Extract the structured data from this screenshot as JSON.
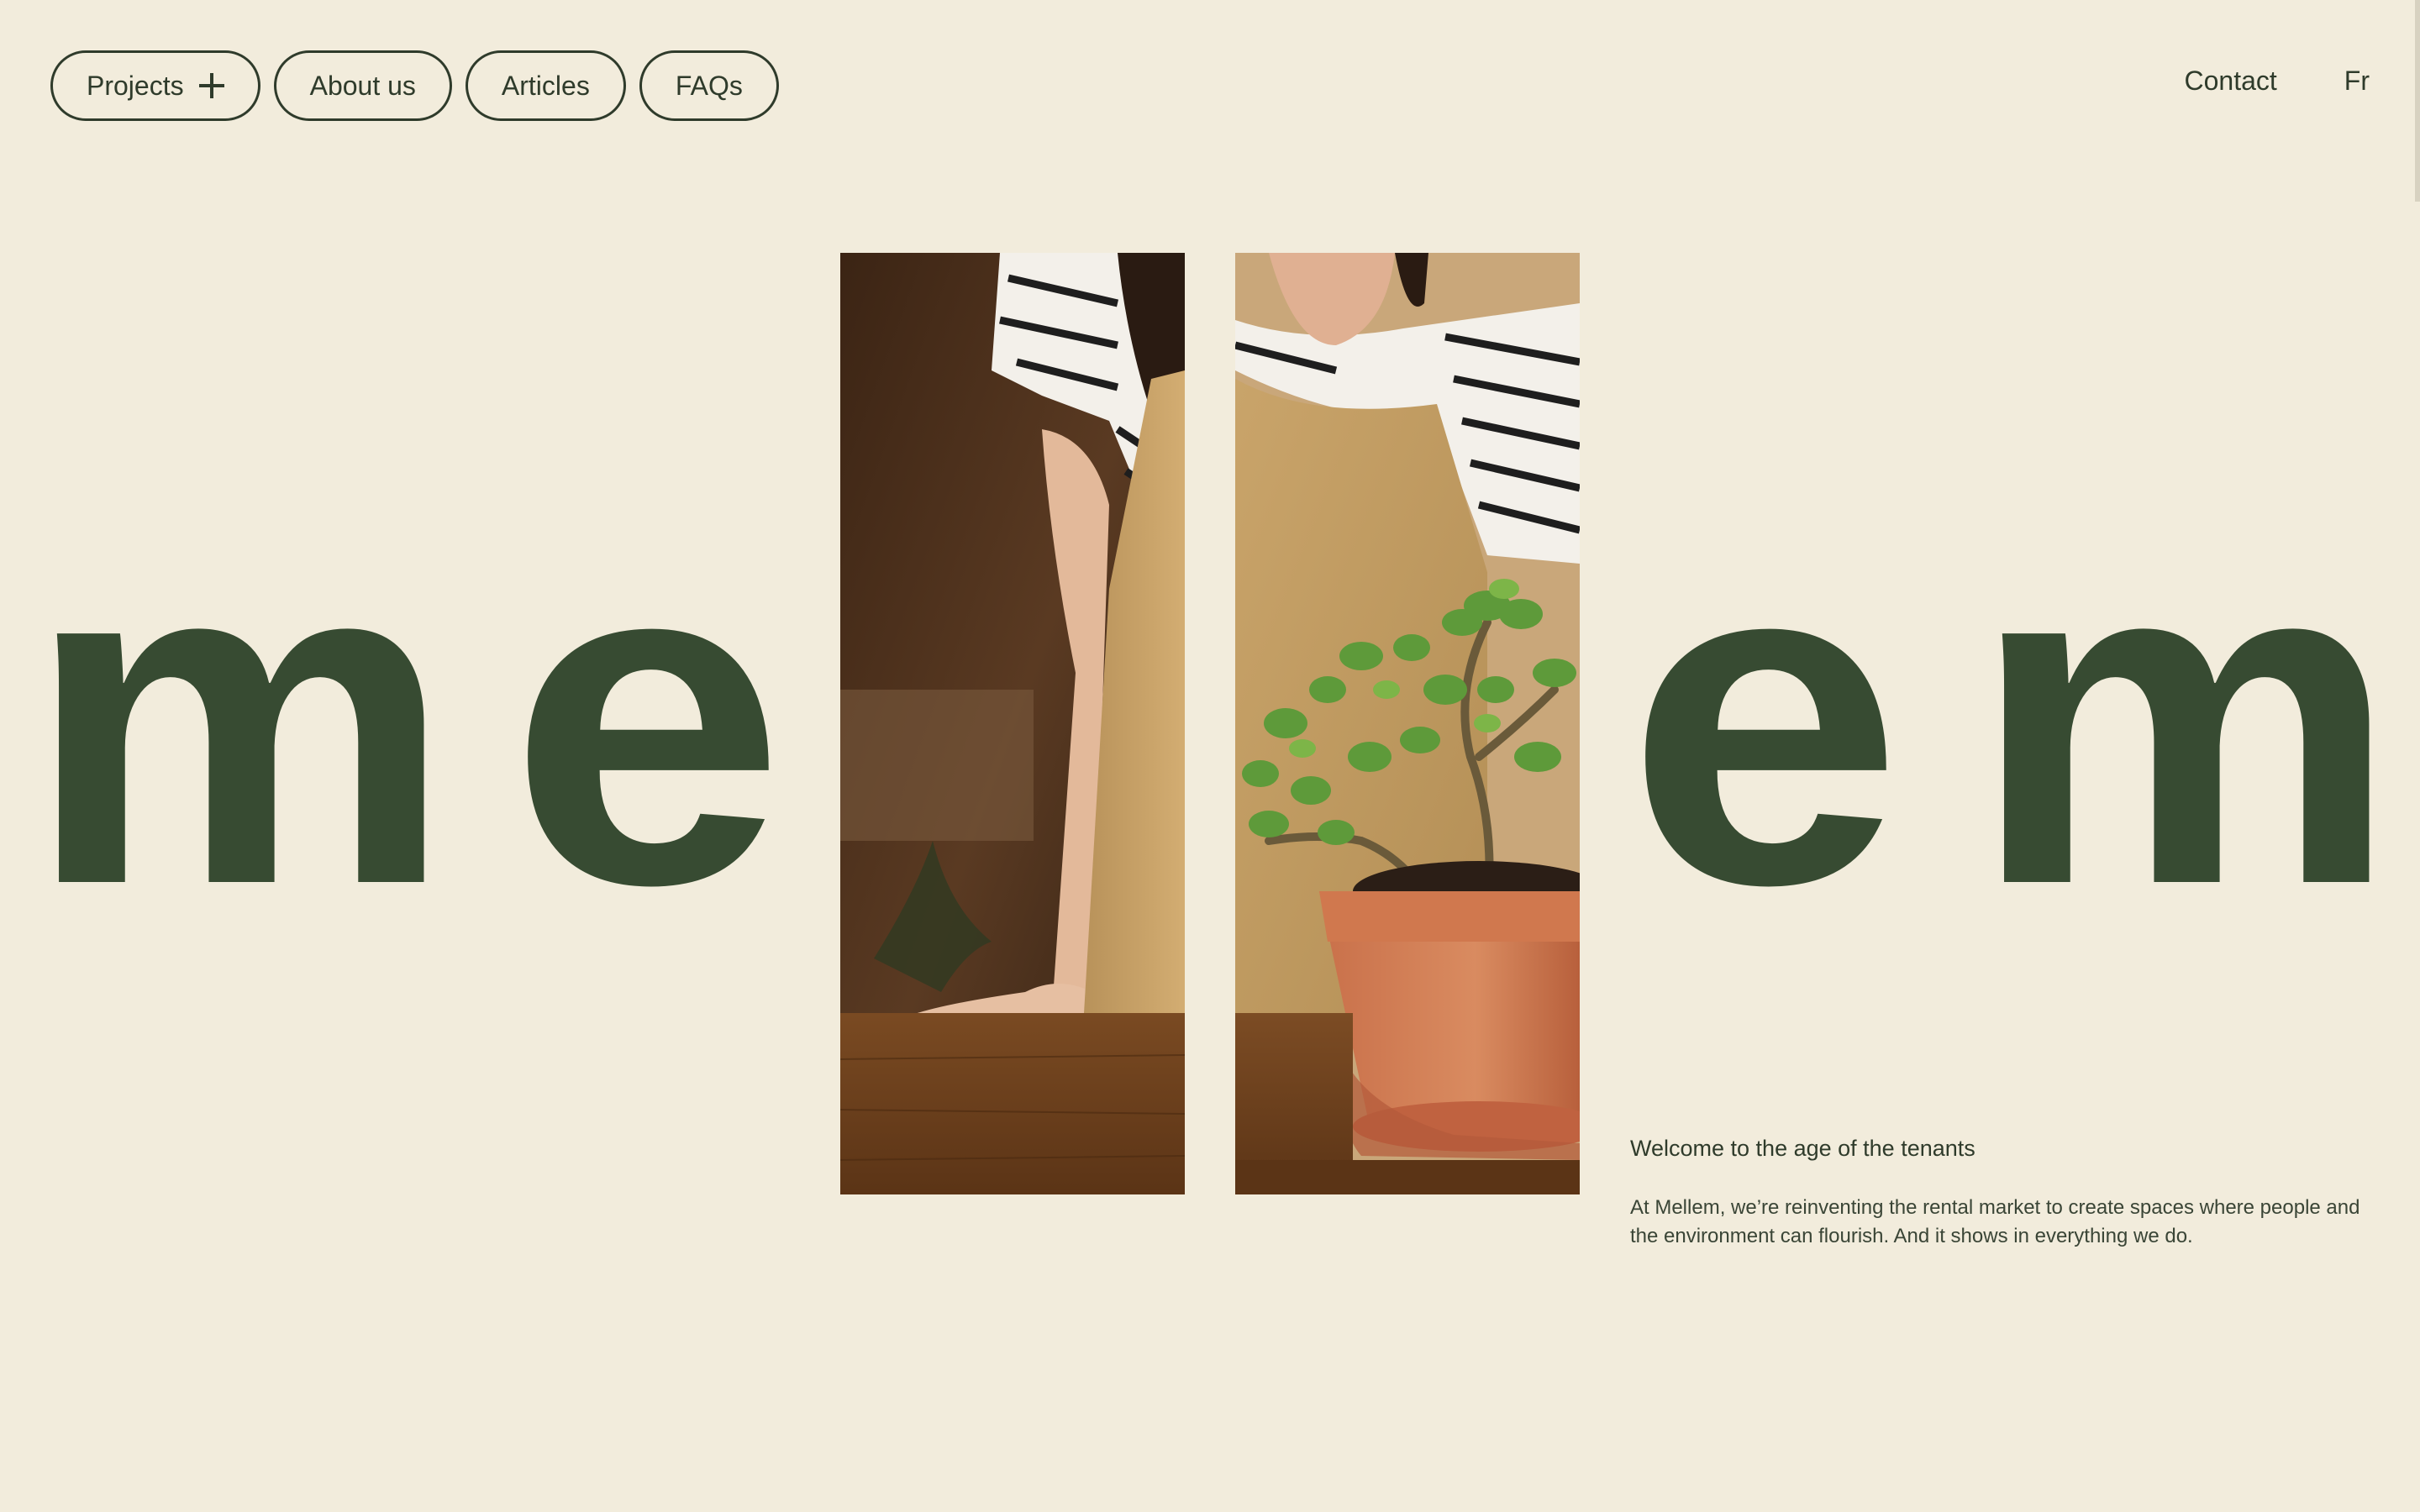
{
  "nav": {
    "projects_label": "Projects",
    "about_label": "About us",
    "articles_label": "Articles",
    "faqs_label": "FAQs",
    "contact_label": "Contact",
    "lang_label": "Fr"
  },
  "hero": {
    "letter_1": "m",
    "letter_2": "e",
    "letter_3": "e",
    "letter_4": "m"
  },
  "intro": {
    "heading": "Welcome to the age of the tenants",
    "body": "At Mellem, we’re reinventing the rental market to create spaces where people and the environment can flourish. And it shows in everything we do."
  },
  "colors": {
    "background": "#F2ECDC",
    "brand_green": "#374B32",
    "text_dark": "#2F3B2B"
  }
}
